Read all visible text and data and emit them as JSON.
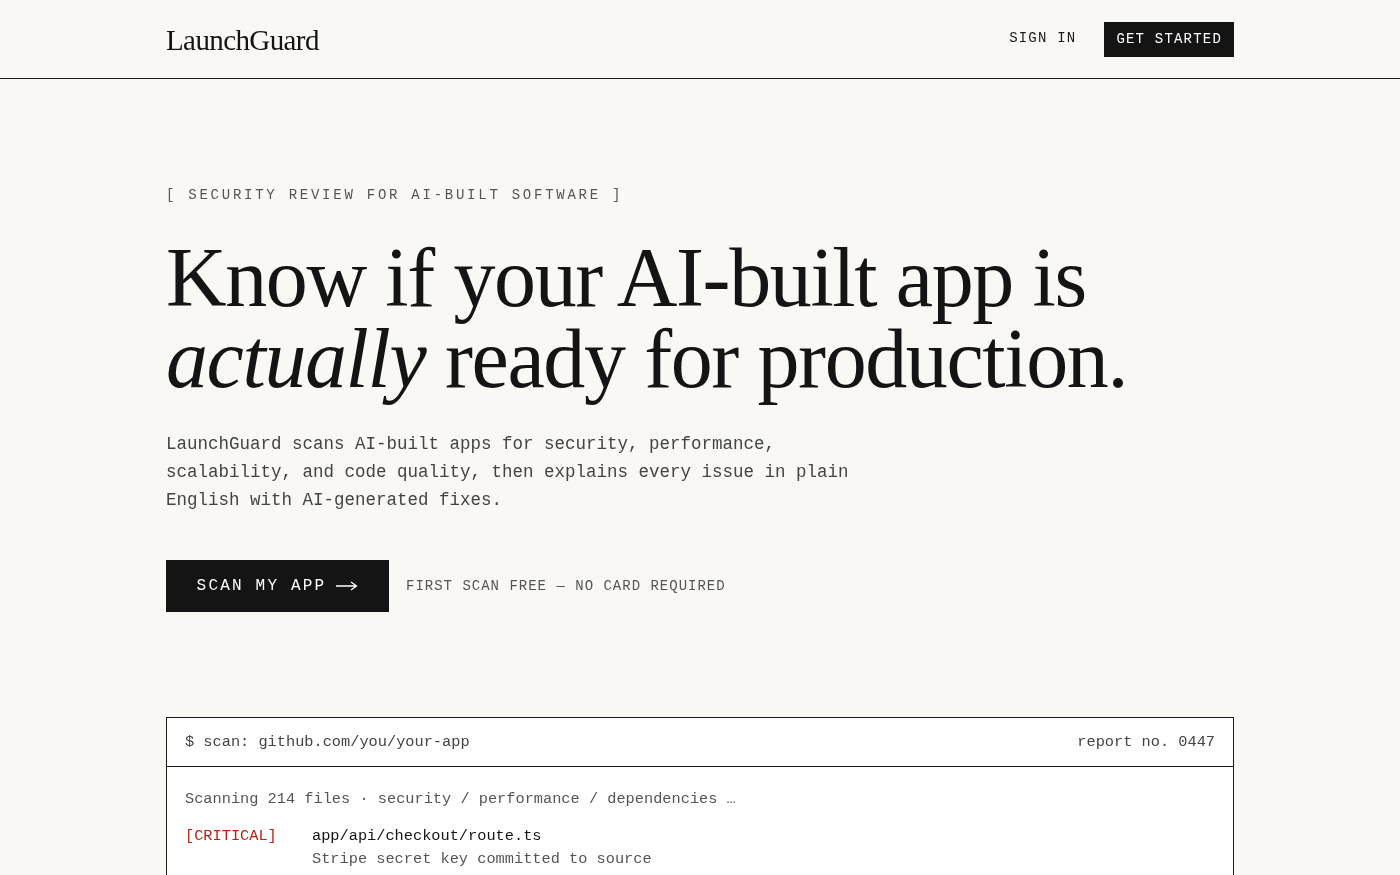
{
  "header": {
    "logo": "LaunchGuard",
    "nav": [
      {
        "label": "SIGN IN",
        "kind": "link"
      },
      {
        "label": "GET STARTED",
        "kind": "button"
      }
    ]
  },
  "hero": {
    "eyebrow": "[ SECURITY REVIEW FOR AI-BUILT SOFTWARE ]",
    "headline": [
      "Know if your AI-built app is",
      "*actually* ready for production."
    ],
    "description": "LaunchGuard scans AI-built apps for security, performance, scalability, and code quality, then explains every issue in plain English with AI-generated fixes.",
    "cta": {
      "label": "SCAN MY APP"
    },
    "note": "FIRST SCAN FREE — NO CARD REQUIRED"
  },
  "terminal": {
    "command": "$ scan: github.com/you/your-app",
    "report": "report no. 0447",
    "status": "Scanning 214 files · security / performance / dependencies …",
    "findings": [
      {
        "tag": "[CRITICAL]",
        "color": "#b42318",
        "file": "app/api/checkout/route.ts",
        "detail": "Stripe secret key committed to source"
      }
    ]
  }
}
